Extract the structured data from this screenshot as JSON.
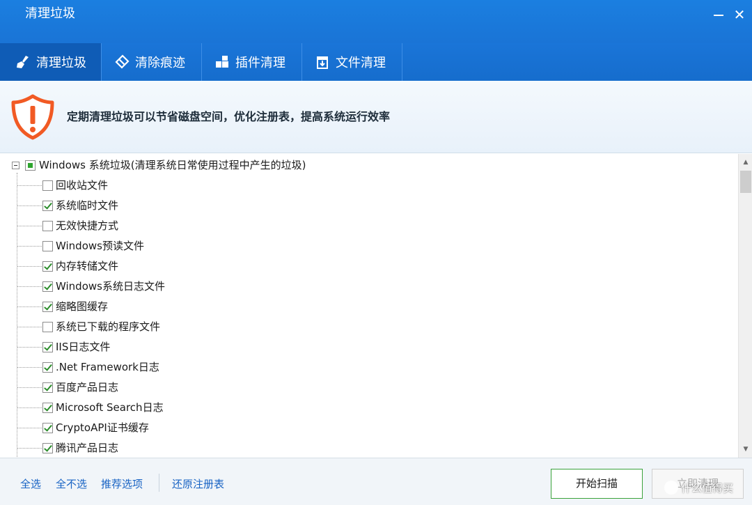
{
  "window": {
    "title": "清理垃圾"
  },
  "tabs": [
    {
      "label": "清理垃圾",
      "icon": "broom-icon",
      "active": true
    },
    {
      "label": "清除痕迹",
      "icon": "eraser-icon",
      "active": false
    },
    {
      "label": "插件清理",
      "icon": "plugin-icon",
      "active": false
    },
    {
      "label": "文件清理",
      "icon": "trash-bin-icon",
      "active": false
    }
  ],
  "banner": {
    "message": "定期清理垃圾可以节省磁盘空间，优化注册表，提高系统运行效率",
    "icon": "warning-shield-icon"
  },
  "tree": {
    "root": {
      "label": "Windows 系统垃圾(清理系统日常使用过程中产生的垃圾)",
      "state": "partial",
      "expanded": true
    },
    "items": [
      {
        "label": "回收站文件",
        "checked": false
      },
      {
        "label": "系统临时文件",
        "checked": true
      },
      {
        "label": "无效快捷方式",
        "checked": false
      },
      {
        "label": "Windows预读文件",
        "checked": false
      },
      {
        "label": "内存转储文件",
        "checked": true
      },
      {
        "label": "Windows系统日志文件",
        "checked": true
      },
      {
        "label": "缩略图缓存",
        "checked": true
      },
      {
        "label": "系统已下载的程序文件",
        "checked": false
      },
      {
        "label": "IIS日志文件",
        "checked": true
      },
      {
        "label": ".Net Framework日志",
        "checked": true
      },
      {
        "label": "百度产品日志",
        "checked": true
      },
      {
        "label": "Microsoft Search日志",
        "checked": true
      },
      {
        "label": "CryptoAPI证书缓存",
        "checked": true
      },
      {
        "label": "腾讯产品日志",
        "checked": true
      }
    ]
  },
  "footer": {
    "select_all": "全选",
    "select_none": "全不选",
    "recommended": "推荐选项",
    "restore_registry": "还原注册表",
    "scan_button": "开始扫描",
    "clean_button": "立即清理"
  },
  "watermark": {
    "text": "什么值得买"
  },
  "colors": {
    "titlebar": "#1b7fe0",
    "tab_active": "#0f5cb6",
    "link": "#1863c4",
    "check": "#2c8d2c",
    "warning": "#f15a24"
  }
}
